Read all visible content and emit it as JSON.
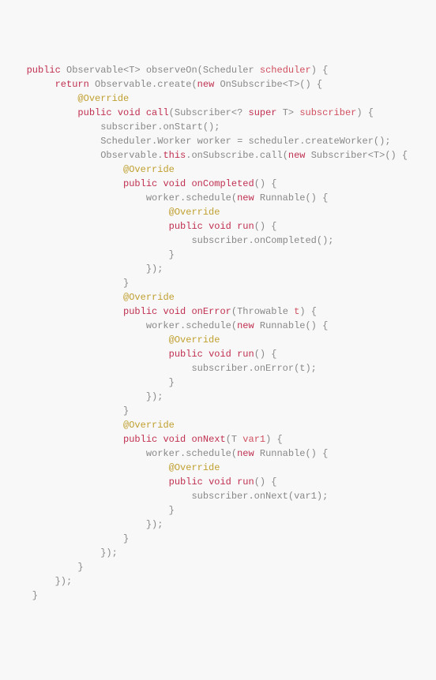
{
  "code": {
    "kw_public": "public",
    "kw_return": "return",
    "kw_new": "new",
    "kw_super": "super",
    "kw_void": "void",
    "kw_this": "this",
    "anno_override": "@Override",
    "type_observable": "Observable",
    "type_scheduler": "Scheduler",
    "type_onsubscribe": "OnSubscribe",
    "type_subscriber": "Subscriber",
    "type_worker": "Worker",
    "type_runnable": "Runnable",
    "type_throwable": "Throwable",
    "type_T": "T",
    "m_observeOn": "observeOn",
    "m_create": "create",
    "m_call": "call",
    "m_onStart": "onStart",
    "m_createWorker": "createWorker",
    "m_onSubscribe": "onSubscribe",
    "m_onCompleted": "onCompleted",
    "m_schedule": "schedule",
    "m_run": "run",
    "m_onError": "onError",
    "m_onNext": "onNext",
    "p_scheduler": "scheduler",
    "p_subscriber": "subscriber",
    "p_worker": "worker",
    "p_t": "t",
    "p_var1": "var1"
  }
}
